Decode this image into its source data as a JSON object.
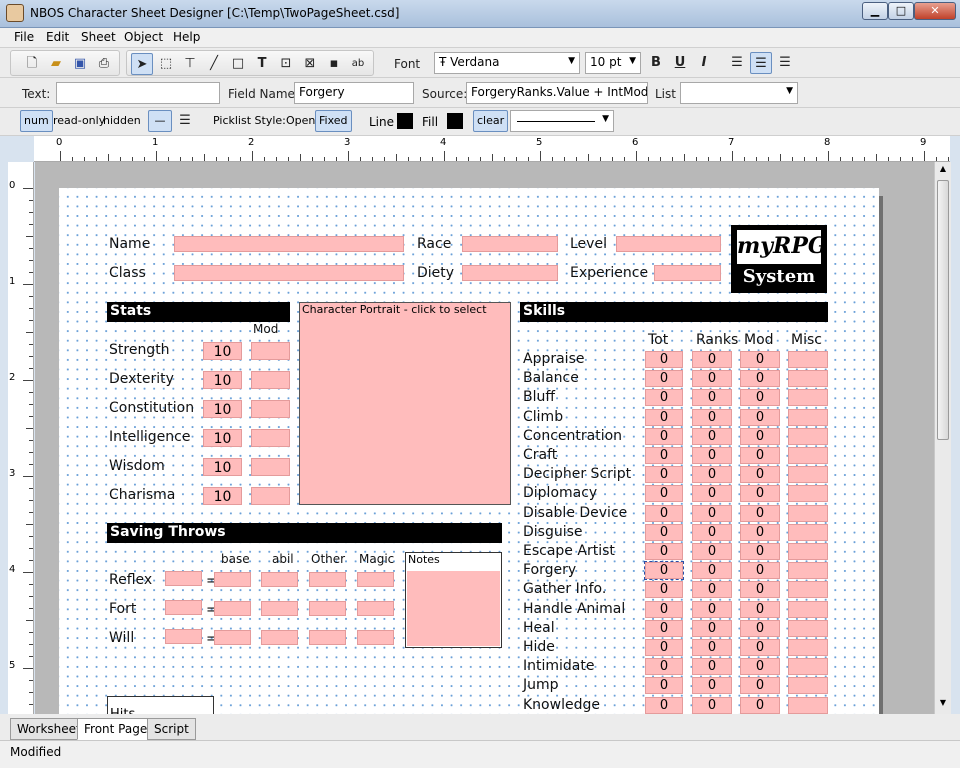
{
  "window": {
    "title": "NBOS Character Sheet Designer [C:\\Temp\\TwoPageSheet.csd]"
  },
  "menu": [
    "File",
    "Edit",
    "Sheet",
    "Object",
    "Help"
  ],
  "toolbar": {
    "font_label": "Font",
    "font_value": "Verdana",
    "size_value": "10 pt",
    "bold": "B",
    "underline": "U",
    "italic": "I"
  },
  "props": {
    "text_label": "Text:",
    "text_value": "",
    "fieldname_label": "Field Name:",
    "fieldname_value": "Forgery",
    "source_label": "Source:",
    "source_value": "ForgeryRanks.Value + IntMod.Val",
    "list_label": "List",
    "list_value": ""
  },
  "opts": {
    "num": "num",
    "readonly": "read-only",
    "hidden": "hidden",
    "picklist_label": "Picklist Style:",
    "open": "Open",
    "fixed": "Fixed",
    "line_label": "Line",
    "fill_label": "Fill",
    "clear": "clear"
  },
  "ruler": {
    "h": [
      "0",
      "1",
      "2",
      "3",
      "4",
      "5",
      "6",
      "7",
      "8",
      "9"
    ],
    "v": [
      "0",
      "1",
      "2",
      "3",
      "4",
      "5"
    ]
  },
  "sheet": {
    "name": "Name",
    "race": "Race",
    "level": "Level",
    "class": "Class",
    "diety": "Diety",
    "experience": "Experience",
    "logo_top": "myRPG",
    "logo_bottom": "System",
    "stats_title": "Stats",
    "mod_header": "Mod",
    "portrait": "Character Portrait - click to select",
    "stats": [
      {
        "label": "Strength",
        "value": "10"
      },
      {
        "label": "Dexterity",
        "value": "10"
      },
      {
        "label": "Constitution",
        "value": "10"
      },
      {
        "label": "Intelligence",
        "value": "10"
      },
      {
        "label": "Wisdom",
        "value": "10"
      },
      {
        "label": "Charisma",
        "value": "10"
      }
    ],
    "saves_title": "Saving Throws",
    "save_headers": [
      "base",
      "abil",
      "Other",
      "Magic"
    ],
    "saves": [
      "Reflex",
      "Fort",
      "Will"
    ],
    "equals": "=",
    "notes": "Notes",
    "hits": "Hits",
    "skills_title": "Skills",
    "skill_headers": [
      "Tot",
      "Ranks",
      "Mod",
      "Misc"
    ],
    "skills": [
      "Appraise",
      "Balance",
      "Bluff",
      "Climb",
      "Concentration",
      "Craft",
      "Decipher Script",
      "Diplomacy",
      "Disable Device",
      "Disguise",
      "Escape Artist",
      "Forgery",
      "Gather Info.",
      "Handle Animal",
      "Heal",
      "Hide",
      "Intimidate",
      "Jump",
      "Knowledge"
    ],
    "zero": "0"
  },
  "tabs": [
    "Worksheet",
    "Front Page",
    "Script"
  ],
  "active_tab": "Front Page",
  "status": "Modified"
}
